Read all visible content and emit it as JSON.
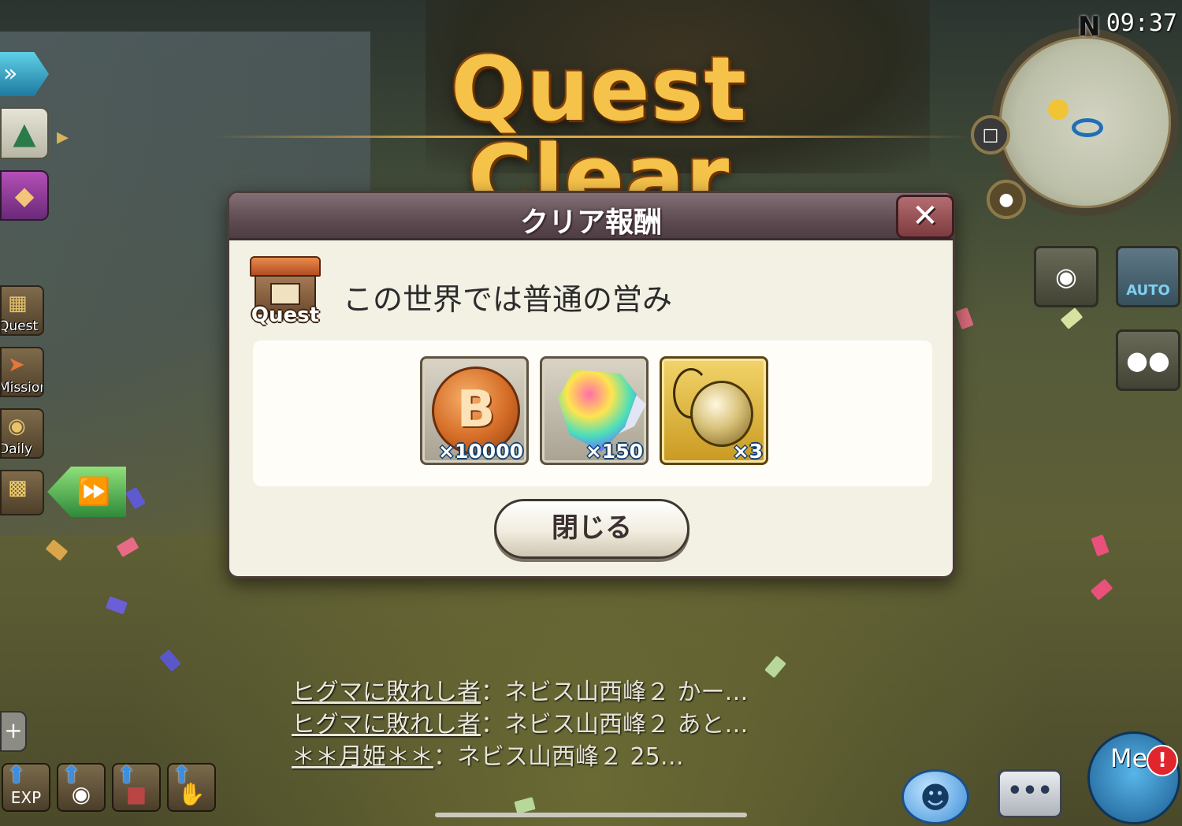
{
  "hud": {
    "clock": "09:37",
    "compass_n": "N",
    "auto_label": "AUTO",
    "me_label": "Me",
    "alert_mark": "!",
    "chat_dots": "•••"
  },
  "banner": {
    "title": "Quest Clear"
  },
  "left_menu": [
    {
      "label": "Quest",
      "icon": "quest-board-icon"
    },
    {
      "label": "Mission",
      "icon": "mission-icon"
    },
    {
      "label": "Daily",
      "icon": "daily-icon"
    }
  ],
  "bottom_bar": [
    {
      "label": "EXP",
      "icon": "exp-upgrade-icon"
    },
    {
      "label": "",
      "icon": "weapon-upgrade-icon"
    },
    {
      "label": "",
      "icon": "boots-upgrade-icon"
    },
    {
      "label": "",
      "icon": "glove-upgrade-icon"
    }
  ],
  "dialog": {
    "title": "クリア報酬",
    "close_icon": "✕",
    "quest_badge_label": "Quest",
    "quest_name": "この世界では普通の営み",
    "rewards": [
      {
        "name": "coin",
        "icon": "bronze-coin-icon",
        "quantity": "×10000",
        "rarity": "silver"
      },
      {
        "name": "rainbow-gem",
        "icon": "rainbow-gem-icon",
        "quantity": "×150",
        "rarity": "silver"
      },
      {
        "name": "bell-charm",
        "icon": "bell-charm-icon",
        "quantity": "×3",
        "rarity": "gold"
      }
    ],
    "close_button": "閉じる"
  },
  "chat_log": [
    {
      "name": "ヒグマに敗れし者",
      "message": "：ネビス山西峰２ かー…"
    },
    {
      "name": "ヒグマに敗れし者",
      "message": "：ネビス山西峰２ あと…"
    },
    {
      "name": "＊＊月姫＊＊",
      "message": "：ネビス山西峰２ 25…"
    }
  ],
  "colors": {
    "title_gold": "#f5c24a",
    "dialog_header": "#5f4b52",
    "dialog_body": "#f3f0e4",
    "quantity_outline": "#14416d"
  }
}
